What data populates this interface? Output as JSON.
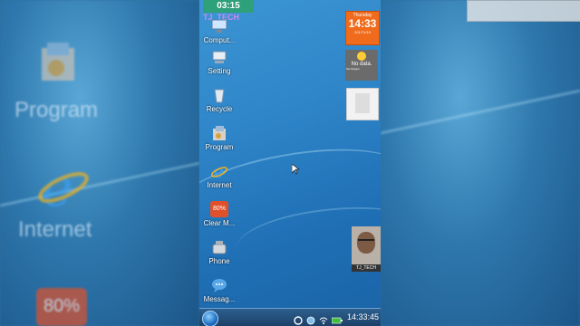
{
  "background": {
    "left_labels": {
      "program": "Program",
      "internet": "Internet",
      "clean_badge": "80%"
    }
  },
  "status": {
    "time": "03:15"
  },
  "brand": {
    "logo_text": "TJ_TECH",
    "watermark": "TJ_TECH"
  },
  "desktop_icons": [
    {
      "label": "Comput...",
      "icon": "computer-icon"
    },
    {
      "label": "Setting",
      "icon": "settings-icon"
    },
    {
      "label": "Recycle",
      "icon": "recycle-bin-icon"
    },
    {
      "label": "Program",
      "icon": "program-icon"
    },
    {
      "label": "Internet",
      "icon": "internet-explorer-icon"
    },
    {
      "label": "Clear M...",
      "icon": "clean-memory-icon",
      "badge": "80%"
    },
    {
      "label": "Phone",
      "icon": "phone-icon"
    },
    {
      "label": "Messag...",
      "icon": "messages-icon"
    }
  ],
  "widgets": {
    "calendar": {
      "day": "Thursday",
      "time": "14:33",
      "date": "2017/1/19"
    },
    "weather": {
      "text": "No data.",
      "location": "Set Region"
    }
  },
  "taskbar": {
    "clock": "14:33:45"
  },
  "colors": {
    "accent_orange": "#f06b1c",
    "status_green": "#2ea07a",
    "taskbar": "#1c3f66"
  }
}
